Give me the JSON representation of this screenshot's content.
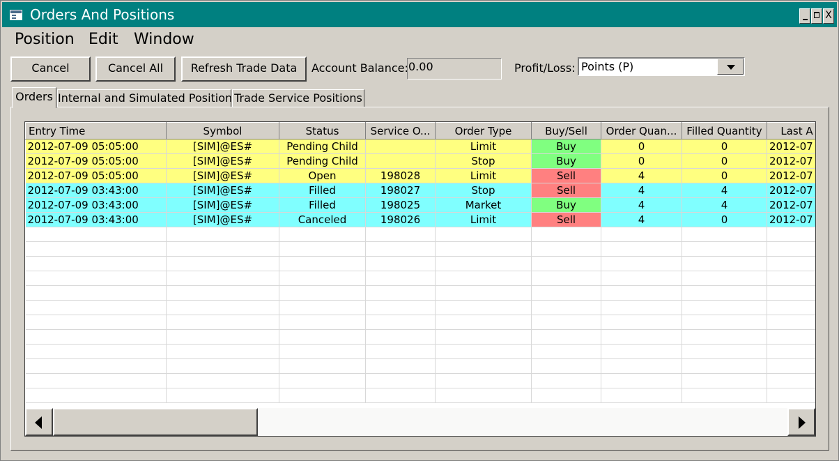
{
  "window": {
    "title": "Orders And Positions",
    "controls": {
      "minimize": "_",
      "maximize": "□",
      "close": "X"
    }
  },
  "menu": [
    "Position",
    "Edit",
    "Window"
  ],
  "toolbar": {
    "cancel_label": "Cancel",
    "cancel_all_label": "Cancel All",
    "refresh_label": "Refresh Trade Data",
    "account_balance_label": "Account Balance:",
    "account_balance_value": "0.00",
    "profit_loss_label": "Profit/Loss:",
    "profit_loss_value": "Points (P)"
  },
  "tabs": [
    "Orders",
    "Internal and Simulated Positions",
    "Trade Service Positions"
  ],
  "active_tab": "Orders",
  "table": {
    "columns": [
      "Entry Time",
      "Symbol",
      "Status",
      "Service O...",
      "Order Type",
      "Buy/Sell",
      "Order Quan...",
      "Filled Quantity",
      "Last A"
    ],
    "rows": [
      [
        "2012-07-09 05:05:00",
        "[SIM]@ES#",
        "Pending Child",
        "",
        "Limit",
        "Buy",
        "0",
        "0",
        "2012-07"
      ],
      [
        "2012-07-09 05:05:00",
        "[SIM]@ES#",
        "Pending Child",
        "",
        "Stop",
        "Buy",
        "0",
        "0",
        "2012-07"
      ],
      [
        "2012-07-09 05:05:00",
        "[SIM]@ES#",
        "Open",
        "198028",
        "Limit",
        "Sell",
        "4",
        "0",
        "2012-07"
      ],
      [
        "2012-07-09 03:43:00",
        "[SIM]@ES#",
        "Filled",
        "198027",
        "Stop",
        "Sell",
        "4",
        "4",
        "2012-07"
      ],
      [
        "2012-07-09 03:43:00",
        "[SIM]@ES#",
        "Filled",
        "198025",
        "Market",
        "Buy",
        "4",
        "4",
        "2012-07"
      ],
      [
        "2012-07-09 03:43:00",
        "[SIM]@ES#",
        "Canceled",
        "198026",
        "Limit",
        "Sell",
        "4",
        "0",
        "2012-07"
      ]
    ],
    "row_colors": [
      "yellow",
      "yellow",
      "yellow",
      "cyan",
      "cyan",
      "cyan"
    ],
    "colors": {
      "pending_row": "#ffff80",
      "filled_row": "#80ffff",
      "buy": "#80ff80",
      "sell": "#ff8080",
      "title_bar": "#008080"
    }
  }
}
